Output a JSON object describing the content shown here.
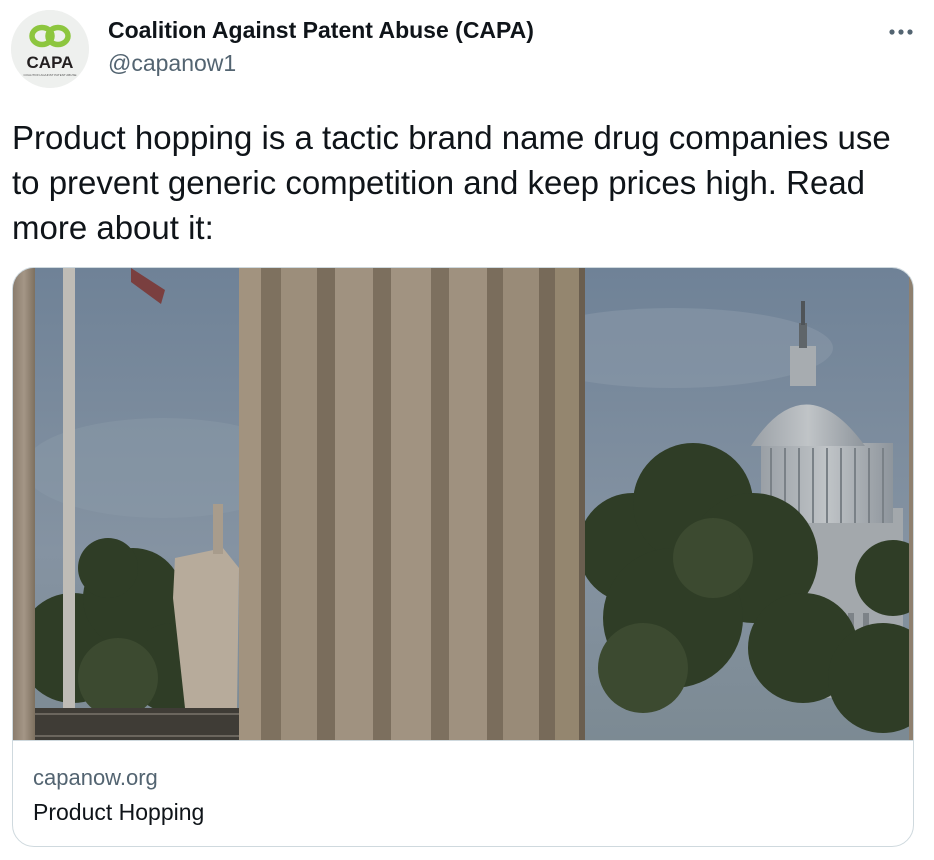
{
  "author": {
    "name": "Coalition Against Patent Abuse (CAPA)",
    "handle": "@capanow1",
    "avatar_label": "CAPA",
    "avatar_subtext": "COALITION AGAINST PATENT ABUSE"
  },
  "tweet": {
    "text": "Product hopping is a tactic brand name drug companies use to prevent generic competition and keep prices high. Read more about it:"
  },
  "link_card": {
    "domain": "capanow.org",
    "title": "Product Hopping"
  },
  "icons": {
    "more": "more-horizontal-icon",
    "avatar_logo": "capa-logo-icon"
  },
  "colors": {
    "text_primary": "#0f1419",
    "text_secondary": "#536471",
    "border": "#cfd9de",
    "logo_green": "#8dc63f"
  }
}
